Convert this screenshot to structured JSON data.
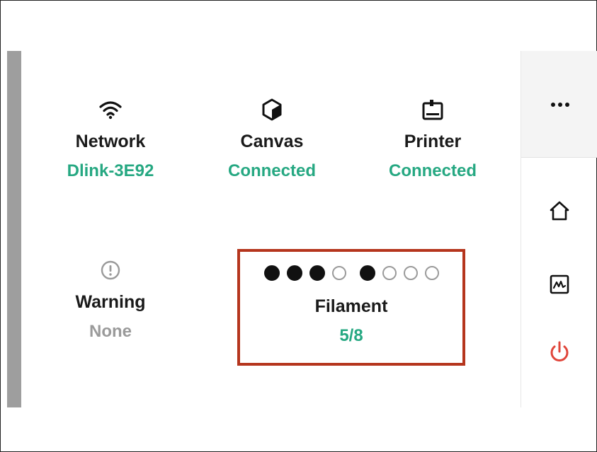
{
  "status": {
    "network": {
      "label": "Network",
      "value": "Dlink-3E92",
      "icon": "wifi-icon"
    },
    "canvas": {
      "label": "Canvas",
      "value": "Connected",
      "icon": "canvas-cube-icon"
    },
    "printer": {
      "label": "Printer",
      "value": "Connected",
      "icon": "printer-icon"
    },
    "warning": {
      "label": "Warning",
      "value": "None",
      "icon": "warning-circle-icon"
    }
  },
  "filament": {
    "label": "Filament",
    "value": "5/8",
    "slots": [
      true,
      true,
      true,
      false,
      true,
      false,
      false,
      false
    ]
  },
  "sidebar": {
    "menu_icon": "more-dots-icon",
    "items": [
      {
        "name": "home",
        "icon": "home-icon"
      },
      {
        "name": "activity",
        "icon": "activity-graph-icon"
      },
      {
        "name": "power",
        "icon": "power-icon",
        "color": "#e0453a"
      }
    ]
  },
  "colors": {
    "accent": "#26a882",
    "muted": "#9a9a9a",
    "highlight_border": "#b5351d",
    "left_bar": "#9e9e9e"
  }
}
